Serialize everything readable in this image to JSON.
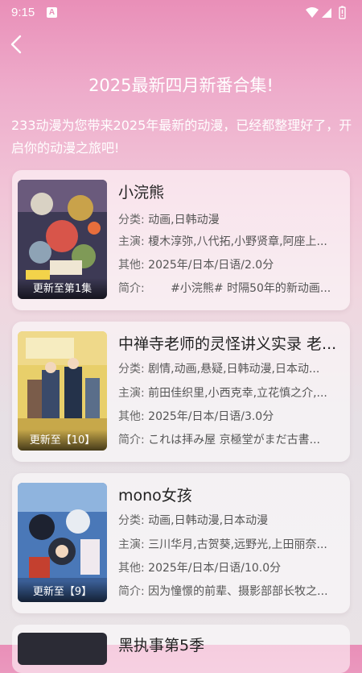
{
  "status_bar": {
    "time": "9:15",
    "notification_icon": "A"
  },
  "header": {
    "title": "2025最新四月新番合集!"
  },
  "intro": "233动漫为您带来2025年最新的动漫，已经都整理好了，开启你的动漫之旅吧!",
  "labels": {
    "category": "分类: ",
    "cast": "主演: ",
    "other": "其他: ",
    "intro": "简介: "
  },
  "cards": [
    {
      "title": "小浣熊",
      "badge": "更新至第1集",
      "category": "动画,日韩动漫",
      "cast": "榎木淳弥,八代拓,小野贤章,阿座上...",
      "other": "2025年/日本/日语/2.0分",
      "intro": "　　#小浣熊# 时隔50年的新动画..."
    },
    {
      "title": "中禅寺老师的灵怪讲义实录 老...",
      "badge": "更新至【10】",
      "category": "剧情,动画,悬疑,日韩动漫,日本动...",
      "cast": "前田佳织里,小西克幸,立花慎之介,...",
      "other": "2025年/日本/日语/3.0分",
      "intro": "これは拝み屋 京極堂がまだ古書..."
    },
    {
      "title": "mono女孩",
      "badge": "更新至【9】",
      "category": "动画,日韩动漫,日本动漫",
      "cast": "三川华月,古贺葵,远野光,上田丽奈...",
      "other": "2025年/日本/日语/10.0分",
      "intro": "因为憧憬的前辈、摄影部部长牧之..."
    }
  ],
  "partial_card": {
    "title": "黑执事第5季"
  }
}
